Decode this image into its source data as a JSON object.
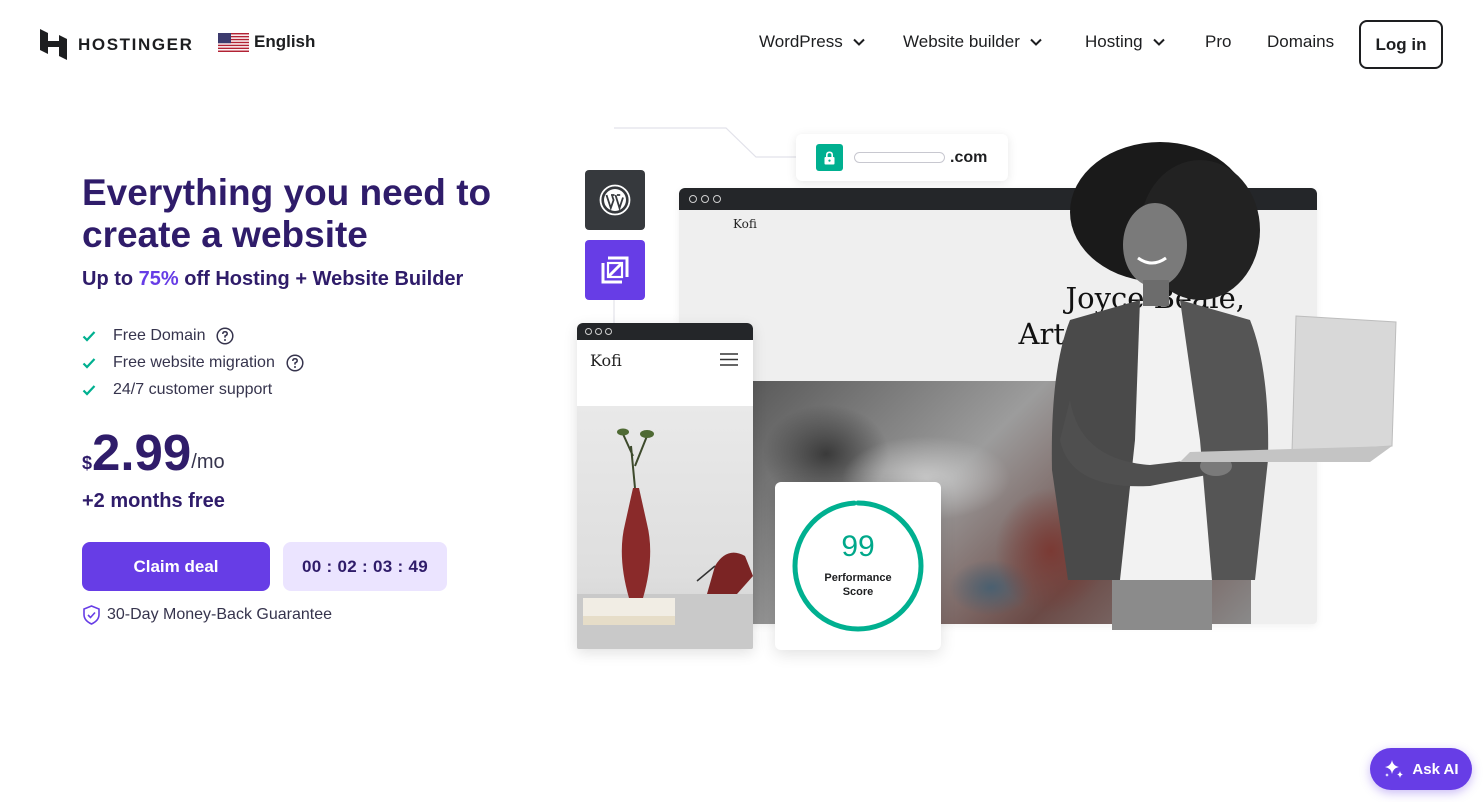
{
  "header": {
    "logo_text": "HOSTINGER",
    "language": "English",
    "nav": [
      {
        "label": "WordPress",
        "has_dropdown": true
      },
      {
        "label": "Website builder",
        "has_dropdown": true
      },
      {
        "label": "Hosting",
        "has_dropdown": true
      },
      {
        "label": "Pro",
        "has_dropdown": false
      },
      {
        "label": "Domains",
        "has_dropdown": false
      }
    ],
    "login_label": "Log in"
  },
  "hero": {
    "title": "Everything you need to create a website",
    "subtitle_prefix": "Up to ",
    "subtitle_accent": "75%",
    "subtitle_suffix": " off Hosting + Website Builder",
    "features": [
      "Free Domain",
      "Free website migration",
      "24/7 customer support"
    ],
    "price_currency": "$",
    "price_amount": "2.99",
    "price_period": "/mo",
    "bonus": "+2 months free",
    "claim_label": "Claim deal",
    "timer": "00 : 02 : 03 : 49",
    "guarantee": "30-Day Money-Back Guarantee"
  },
  "illustration": {
    "url_tld": ".com",
    "desktop_brand": "Kofi",
    "desktop_headline_line1": "Joyce Beale,",
    "desktop_headline_line2": "Art photograph",
    "mobile_brand": "Kofi",
    "performance_score": "99",
    "performance_label_line1": "Performance",
    "performance_label_line2": "Score",
    "performance_fraction": 0.99
  },
  "ask_ai_label": "Ask AI",
  "colors": {
    "brand_purple": "#673de6",
    "heading": "#2f1c6a",
    "success_green": "#00b090",
    "timer_bg": "#ebe4ff"
  }
}
